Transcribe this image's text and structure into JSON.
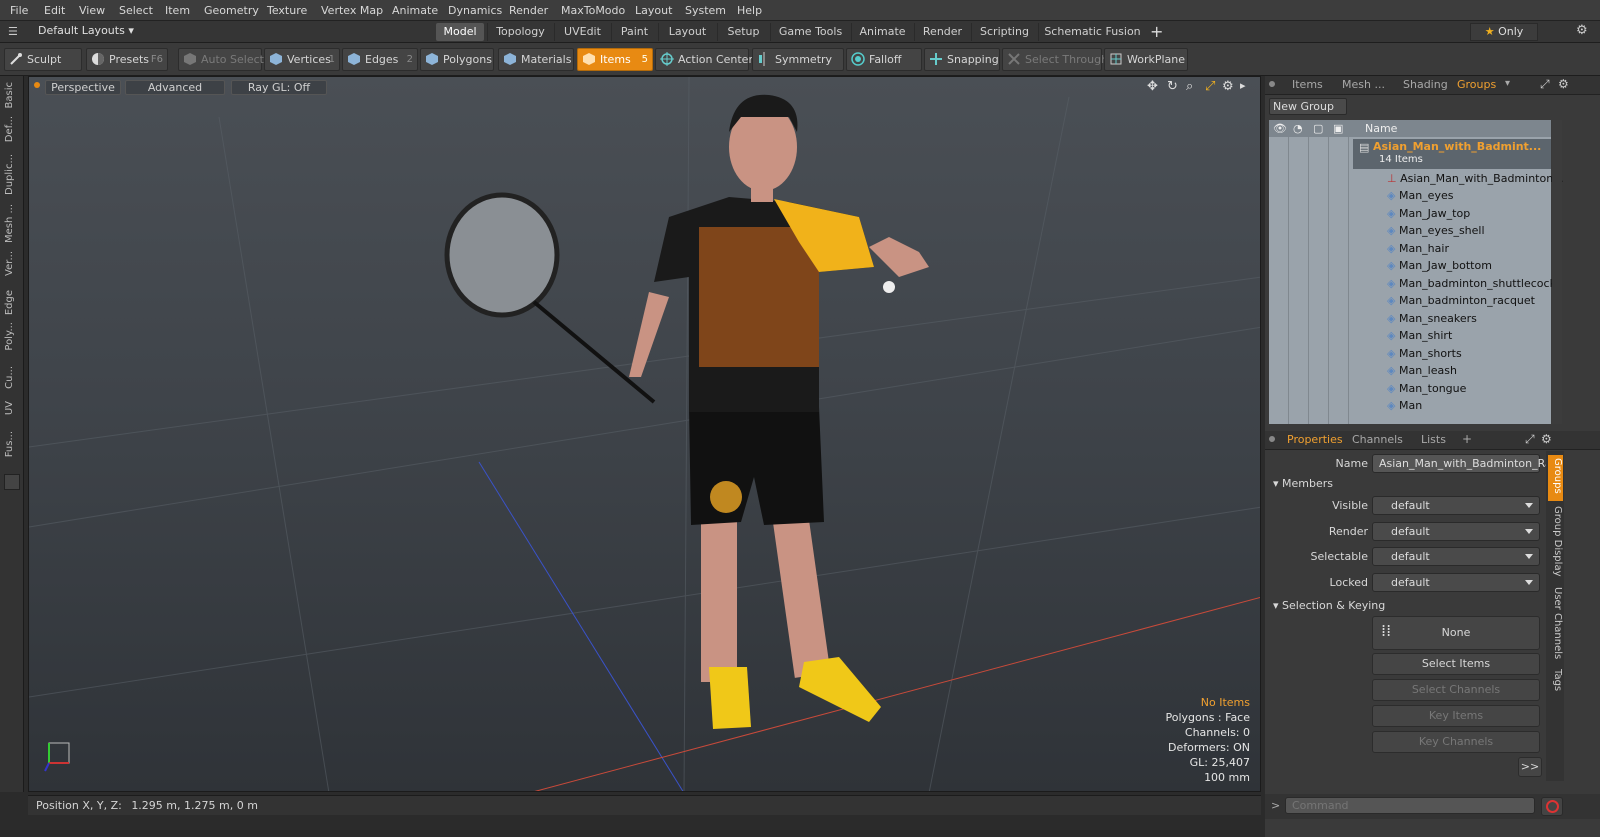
{
  "menu": [
    "File",
    "Edit",
    "View",
    "Select",
    "Item",
    "Geometry",
    "Texture",
    "Vertex Map",
    "Animate",
    "Dynamics",
    "Render",
    "MaxToModo",
    "Layout",
    "System",
    "Help"
  ],
  "layouts": {
    "dropdown": "Default Layouts",
    "tabs": [
      "Model",
      "Topology",
      "UVEdit",
      "Paint",
      "Layout",
      "Setup",
      "Game Tools",
      "Animate",
      "Render",
      "Scripting",
      "Schematic Fusion"
    ],
    "active": "Model",
    "only_label": "Only"
  },
  "toolbar": {
    "sculpt": "Sculpt",
    "presets": "Presets",
    "presets_key": "F6",
    "auto_select": "Auto Select",
    "vertices": "Vertices",
    "vertices_key": "1",
    "edges": "Edges",
    "edges_key": "2",
    "polygons": "Polygons",
    "materials": "Materials",
    "items": "Items",
    "items_key": "5",
    "action_center": "Action Center",
    "symmetry": "Symmetry",
    "falloff": "Falloff",
    "snapping": "Snapping",
    "select_through": "Select Through",
    "workplane": "WorkPlane"
  },
  "left_tabs": [
    "Basic",
    "Def...",
    "Duplic...",
    "Mesh ...",
    "Ver...",
    "Edge",
    "Poly...",
    "Cu...",
    "UV",
    "Fus..."
  ],
  "viewport": {
    "view": "Perspective",
    "shading": "Advanced",
    "raygl": "Ray GL: Off",
    "hud": {
      "items": "No Items",
      "polygons": "Polygons : Face",
      "channels": "Channels: 0",
      "deformers": "Deformers: ON",
      "gl": "GL: 25,407",
      "scale": "100 mm"
    }
  },
  "status": {
    "label": "Position X, Y, Z:",
    "value": "1.295 m, 1.275 m, 0 m"
  },
  "outliner": {
    "tabs": [
      "Items",
      "Mesh ...",
      "Shading",
      "Groups"
    ],
    "active": "Groups",
    "new_group": "New Group",
    "name_col": "Name",
    "group_name": "Asian_Man_with_Badmint...",
    "group_count": "14 Items",
    "items": [
      "Asian_Man_with_Badminton...",
      "Man_eyes",
      "Man_Jaw_top",
      "Man_eyes_shell",
      "Man_hair",
      "Man_Jaw_bottom",
      "Man_badminton_shuttlecock",
      "Man_badminton_racquet",
      "Man_sneakers",
      "Man_shirt",
      "Man_shorts",
      "Man_leash",
      "Man_tongue",
      "Man"
    ]
  },
  "properties": {
    "tabs": [
      "Properties",
      "Channels",
      "Lists"
    ],
    "active": "Properties",
    "name_label": "Name",
    "name_value": "Asian_Man_with_Badminton_Rac",
    "members_header": "Members",
    "fields": [
      {
        "label": "Visible",
        "value": "default"
      },
      {
        "label": "Render",
        "value": "default"
      },
      {
        "label": "Selectable",
        "value": "default"
      },
      {
        "label": "Locked",
        "value": "default"
      }
    ],
    "sel_header": "Selection & Keying",
    "none_btn": "None",
    "select_items": "Select Items",
    "select_channels": "Select Channels",
    "key_items": "Key Items",
    "key_channels": "Key Channels",
    "more": ">>",
    "side_tabs": [
      "Groups",
      "Group Display",
      "User Channels",
      "Tags"
    ]
  },
  "command": {
    "placeholder": "Command"
  },
  "colors": {
    "accent": "#e88a12",
    "group_text": "#f0a030"
  }
}
